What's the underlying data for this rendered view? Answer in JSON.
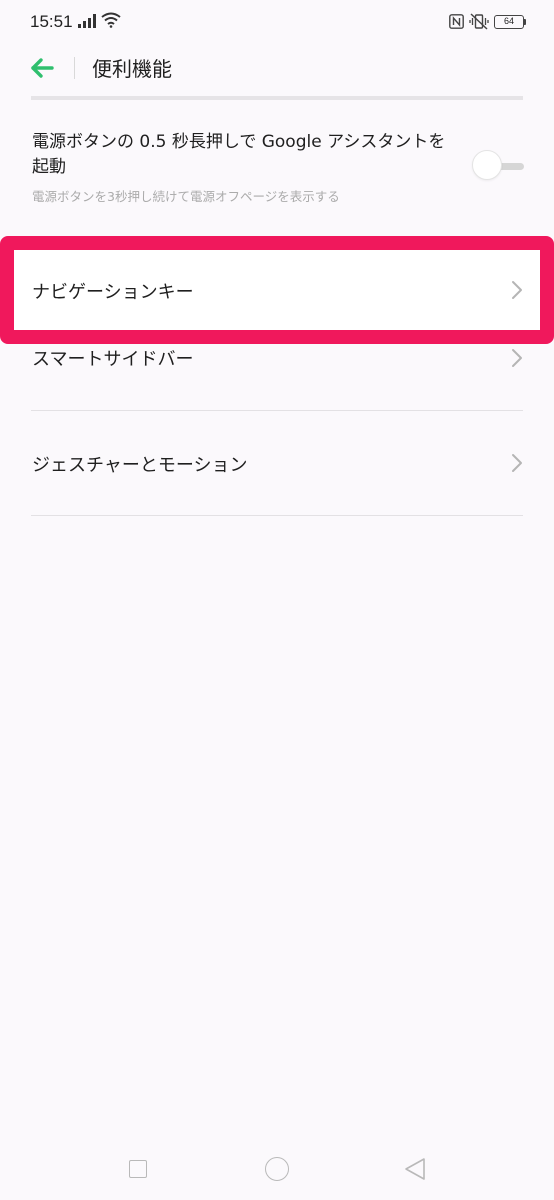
{
  "status_bar": {
    "time": "15:51",
    "battery": "64",
    "icons": [
      "signal-icon",
      "wifi-icon",
      "nfc-icon",
      "vibrate-off-icon",
      "battery-icon"
    ]
  },
  "header": {
    "back_icon": "arrow-left-icon",
    "title": "便利機能"
  },
  "settings": {
    "power_button": {
      "title": "電源ボタンの 0.5 秒長押しで Google アシスタントを起動",
      "subtitle": "電源ボタンを3秒押し続けて電源オフページを表示する",
      "toggle_on": false
    },
    "items": [
      {
        "label": "ナビゲーションキー",
        "highlighted": true
      },
      {
        "label": "スマートサイドバー",
        "highlighted": false
      },
      {
        "label": "ジェスチャーとモーション",
        "highlighted": false
      }
    ]
  },
  "colors": {
    "accent": "#2fbf6e",
    "highlight": "#f0185c",
    "background": "#fbf9fc"
  },
  "bottom_nav": {
    "icons": [
      "recents-icon",
      "home-icon",
      "back-icon"
    ]
  }
}
